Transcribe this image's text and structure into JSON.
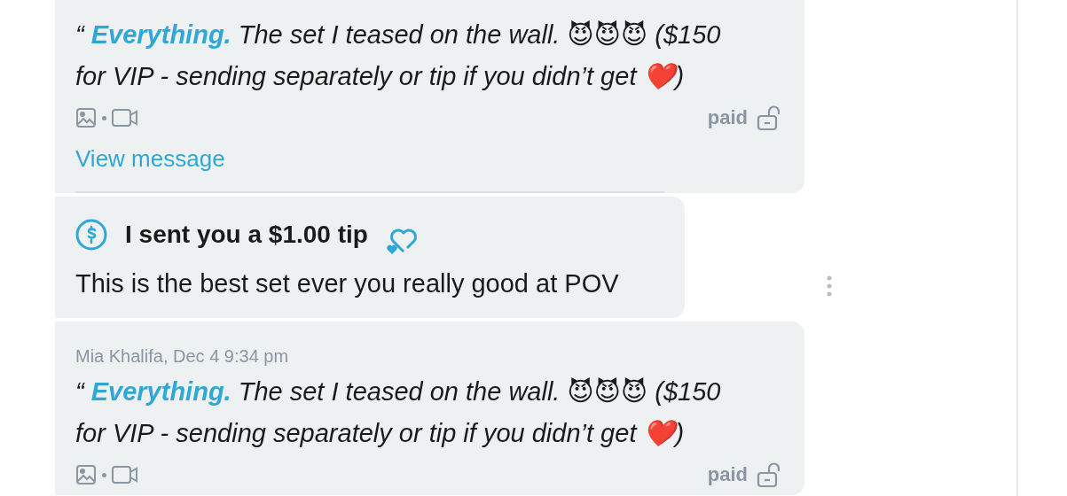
{
  "messages": [
    {
      "kind": "paid_message",
      "text": "“ **Everything.** The set I teased on the wall. 😈😈😈 ($150 for VIP - sending separately or tip if you didn’t get ❤️)",
      "status": "paid",
      "locked": false,
      "link": "View message"
    },
    {
      "kind": "tip",
      "title": "I sent you a $1.00 tip",
      "text": "This is the best set ever you really good at POV"
    },
    {
      "kind": "paid_message",
      "meta": "Mia Khalifa, Dec 4 9:34 pm",
      "text": "“ **Everything.** The set I teased on the wall. 😈😈😈 ($150 for VIP - sending separately or tip if you didn’t get ❤️)",
      "status": "paid",
      "locked": false
    }
  ]
}
